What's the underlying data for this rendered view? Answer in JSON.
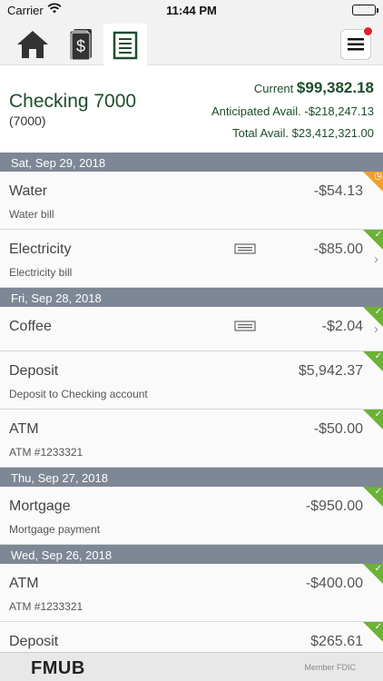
{
  "status": {
    "carrier": "Carrier",
    "time": "11:44 PM"
  },
  "account": {
    "name": "Checking 7000",
    "number": "(7000)",
    "current_label": "Current",
    "current_value": "$99,382.18",
    "anticipated": "Anticipated Avail. -$218,247.13",
    "total": "Total Avail. $23,412,321.00"
  },
  "groups": [
    {
      "date": "Sat, Sep 29, 2018",
      "txns": [
        {
          "name": "Water",
          "desc": "Water bill",
          "amount": "-$54.13",
          "status": "pending-icon"
        },
        {
          "name": "Electricity",
          "desc": "Electricity bill",
          "amount": "-$85.00",
          "status": "check-icon"
        }
      ]
    },
    {
      "date": "Fri, Sep 28, 2018",
      "txns": [
        {
          "name": "Coffee",
          "desc": "",
          "amount": "-$2.04",
          "status": "check-icon"
        },
        {
          "name": "Deposit",
          "desc": "Deposit to Checking account",
          "amount": "$5,942.37",
          "status": "check-icon"
        },
        {
          "name": "ATM",
          "desc": "ATM #1233321",
          "amount": "-$50.00",
          "status": "check-icon"
        }
      ]
    },
    {
      "date": "Thu, Sep 27, 2018",
      "txns": [
        {
          "name": "Mortgage",
          "desc": "Mortgage payment",
          "amount": "-$950.00",
          "status": "check-icon"
        }
      ]
    },
    {
      "date": "Wed, Sep 26, 2018",
      "txns": [
        {
          "name": "ATM",
          "desc": "ATM #1233321",
          "amount": "-$400.00",
          "status": "check-icon"
        },
        {
          "name": "Deposit",
          "desc": "",
          "amount": "$265.61",
          "status": "check-icon"
        }
      ]
    }
  ],
  "footer": {
    "brand": "FMUB",
    "fdic": "Member FDIC"
  },
  "colors": {
    "accent": "#1d4d2c",
    "date_header": "#7e8795",
    "check": "#6bb235",
    "pending": "#f0a02a"
  }
}
